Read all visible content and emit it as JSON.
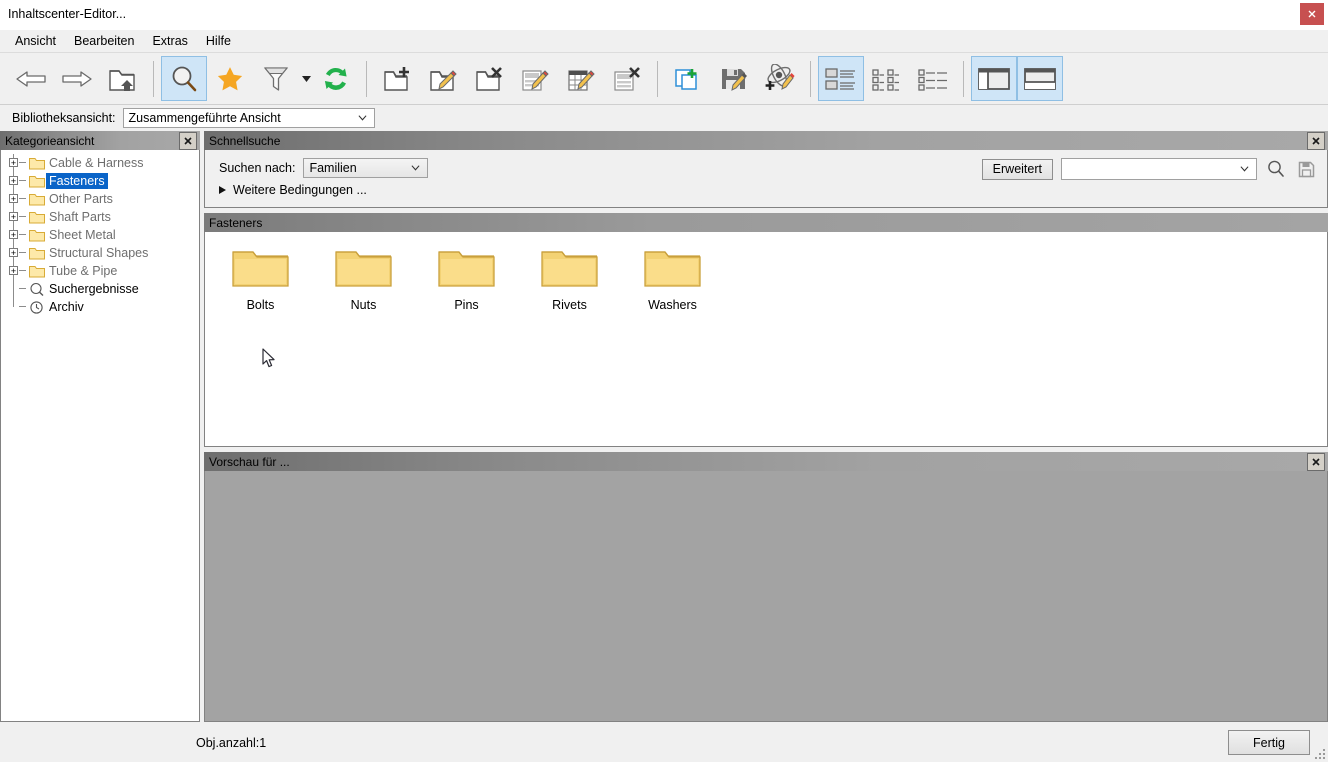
{
  "window": {
    "title": "Inhaltscenter-Editor...",
    "close_label": "✖"
  },
  "menubar": {
    "items": [
      {
        "label": "Ansicht"
      },
      {
        "label": "Bearbeiten"
      },
      {
        "label": "Extras"
      },
      {
        "label": "Hilfe"
      }
    ]
  },
  "toolbar": {
    "buttons": [
      {
        "name": "back-arrow-icon",
        "tip": "Zurück"
      },
      {
        "name": "forward-arrow-icon",
        "tip": "Vorwärts"
      },
      {
        "name": "folder-up-icon",
        "tip": "Übergeordnete Ebene"
      },
      {
        "name": "search-icon",
        "tip": "Suchen",
        "active": true
      },
      {
        "name": "star-icon",
        "tip": "Favoriten"
      },
      {
        "name": "filter-icon",
        "tip": "Filter"
      },
      {
        "name": "filter-dropdown-caret-icon",
        "tip": "Filteroptionen"
      },
      {
        "name": "refresh-icon",
        "tip": "Aktualisieren"
      },
      {
        "name": "new-folder-icon",
        "tip": "Neue Kategorie"
      },
      {
        "name": "edit-folder-icon",
        "tip": "Kategorie bearbeiten"
      },
      {
        "name": "delete-folder-icon",
        "tip": "Kategorie löschen"
      },
      {
        "name": "edit-family-icon",
        "tip": "Familie bearbeiten"
      },
      {
        "name": "edit-table-icon",
        "tip": "Tabelle bearbeiten"
      },
      {
        "name": "delete-table-icon",
        "tip": "Tabelle löschen"
      },
      {
        "name": "copy-new-icon",
        "tip": "Kopie erstellen"
      },
      {
        "name": "save-edit-icon",
        "tip": "Speichern"
      },
      {
        "name": "publish-edit-icon",
        "tip": "Veröffentlichen"
      },
      {
        "name": "view-detail-icon",
        "tip": "Detailansicht",
        "active": true
      },
      {
        "name": "view-tiles-icon",
        "tip": "Kachelansicht"
      },
      {
        "name": "view-list-icon",
        "tip": "Listenansicht"
      },
      {
        "name": "layout-vertical-split-icon",
        "tip": "Vertikal teilen",
        "active": true
      },
      {
        "name": "layout-horizontal-split-icon",
        "tip": "Horizontal teilen",
        "active": true
      }
    ]
  },
  "library_view": {
    "label": "Bibliotheksansicht:",
    "value": "Zusammengeführte Ansicht"
  },
  "category_panel": {
    "title": "Kategorieansicht",
    "close_label": "✖",
    "tree": [
      {
        "label": "Cable & Harness",
        "icon": "folder-icon",
        "expandable": true,
        "selected": false,
        "muted": true
      },
      {
        "label": "Fasteners",
        "icon": "folder-icon",
        "expandable": true,
        "selected": true,
        "muted": false
      },
      {
        "label": "Other Parts",
        "icon": "folder-icon",
        "expandable": true,
        "selected": false,
        "muted": true
      },
      {
        "label": "Shaft Parts",
        "icon": "folder-icon",
        "expandable": true,
        "selected": false,
        "muted": true
      },
      {
        "label": "Sheet Metal",
        "icon": "folder-icon",
        "expandable": true,
        "selected": false,
        "muted": true
      },
      {
        "label": "Structural Shapes",
        "icon": "folder-icon",
        "expandable": true,
        "selected": false,
        "muted": true
      },
      {
        "label": "Tube & Pipe",
        "icon": "folder-icon",
        "expandable": true,
        "selected": false,
        "muted": true
      },
      {
        "label": "Suchergebnisse",
        "icon": "magnifier-icon",
        "expandable": false,
        "selected": false,
        "muted": false
      },
      {
        "label": "Archiv",
        "icon": "clock-icon",
        "expandable": false,
        "selected": false,
        "muted": false
      }
    ]
  },
  "quick_search": {
    "title": "Schnellsuche",
    "close_label": "✖",
    "search_for_label": "Suchen nach:",
    "search_for_value": "Familien",
    "more_conditions_label": "Weitere Bedingungen ...",
    "advanced_button": "Erweitert",
    "search_input_value": "",
    "search_icon": "magnifier-icon",
    "save_icon": "floppy-save-icon"
  },
  "results_panel": {
    "title": "Fasteners",
    "items": [
      {
        "label": "Bolts",
        "icon": "folder-icon"
      },
      {
        "label": "Nuts",
        "icon": "folder-icon"
      },
      {
        "label": "Pins",
        "icon": "folder-icon"
      },
      {
        "label": "Rivets",
        "icon": "folder-icon"
      },
      {
        "label": "Washers",
        "icon": "folder-icon"
      }
    ]
  },
  "preview_panel": {
    "title": "Vorschau für ...",
    "close_label": "✖"
  },
  "statusbar": {
    "object_count": "Obj.anzahl:1",
    "done_button": "Fertig"
  },
  "colors": {
    "accent_selection": "#0a64c8",
    "toolbar_active": "#cfe5f7",
    "close_button": "#c75050",
    "folder_yellow": "#f5d76e",
    "panel_header_grey": "#8b8b8b",
    "preview_body_grey": "#a3a3a3"
  }
}
